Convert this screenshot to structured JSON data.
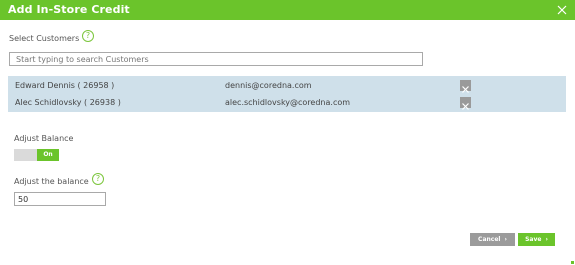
{
  "dialog": {
    "title": "Add In-Store Credit",
    "close_icon": "close-icon"
  },
  "customers": {
    "label": "Select Customers",
    "help_glyph": "?",
    "search_placeholder": "Start typing to search Customers",
    "search_value": "",
    "list": [
      {
        "name": "Edward Dennis ( 26958 )",
        "email": "dennis@coredna.com"
      },
      {
        "name": "Alec Schidlovsky ( 26938 )",
        "email": "alec.schidlovsky@coredna.com"
      }
    ]
  },
  "adjust_balance": {
    "label": "Adjust Balance",
    "toggle_on_label": "On",
    "toggle_state": "on"
  },
  "adjust_amount": {
    "label": "Adjust the balance",
    "help_glyph": "?",
    "value": "50"
  },
  "actions": {
    "cancel_label": "Cancel",
    "save_label": "Save",
    "chevron": "›"
  },
  "colors": {
    "accent": "#6bc42b",
    "list_bg": "#cfe0ea",
    "cancel_bg": "#9b9b9b"
  }
}
